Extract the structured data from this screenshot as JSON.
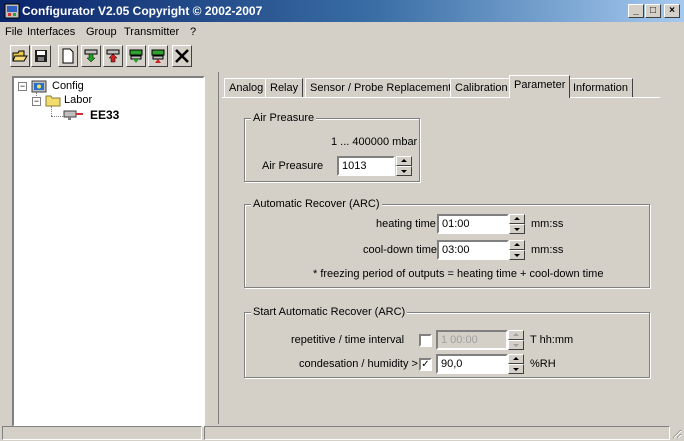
{
  "window": {
    "title": "Configurator  V2.05 Copyright © 2002-2007",
    "minimize_glyph": "_",
    "maximize_glyph": "□",
    "close_glyph": "×"
  },
  "menu": [
    "File",
    "Interfaces",
    "Group",
    "Transmitter",
    "?"
  ],
  "toolbar": {
    "icons": [
      "open-folder-icon",
      "save-disk-icon",
      "new-document-icon",
      "download-green-icon",
      "upload-red-icon",
      "download-device-icon",
      "upload-device-icon",
      "disconnect-icon"
    ]
  },
  "tree": {
    "root": {
      "label": "Config",
      "expander": "−"
    },
    "group": {
      "label": "Labor",
      "expander": "−"
    },
    "device": {
      "label": "EE33"
    }
  },
  "tabs": [
    {
      "label": "Analog",
      "active": false
    },
    {
      "label": "Relay",
      "active": false
    },
    {
      "label": "Sensor / Probe Replacement",
      "active": false
    },
    {
      "label": "Calibration",
      "active": false
    },
    {
      "label": "Parameter",
      "active": true
    },
    {
      "label": "Information",
      "active": false
    }
  ],
  "air_pressure": {
    "legend": "Air Preasure",
    "range": "1 ... 400000 mbar",
    "label": "Air Preasure",
    "value": "1013"
  },
  "arc": {
    "legend": "Automatic Recover (ARC)",
    "heating_label": "heating time",
    "heating_value": "01:00",
    "heating_unit": "mm:ss",
    "cooldown_label": "cool-down time",
    "cooldown_value": "03:00",
    "cooldown_unit": "mm:ss",
    "note": "* freezing period of outputs = heating time + cool-down time"
  },
  "start_arc": {
    "legend": "Start Automatic Recover (ARC)",
    "repetitive_label": "repetitive / time interval",
    "repetitive_checked": false,
    "repetitive_value": "1 00:00",
    "repetitive_unit": "T hh:mm",
    "condensation_label": "condesation / humidity >",
    "condensation_checked": true,
    "condensation_check_glyph": "✓",
    "condensation_value": "90,0",
    "condensation_unit": "%RH"
  }
}
